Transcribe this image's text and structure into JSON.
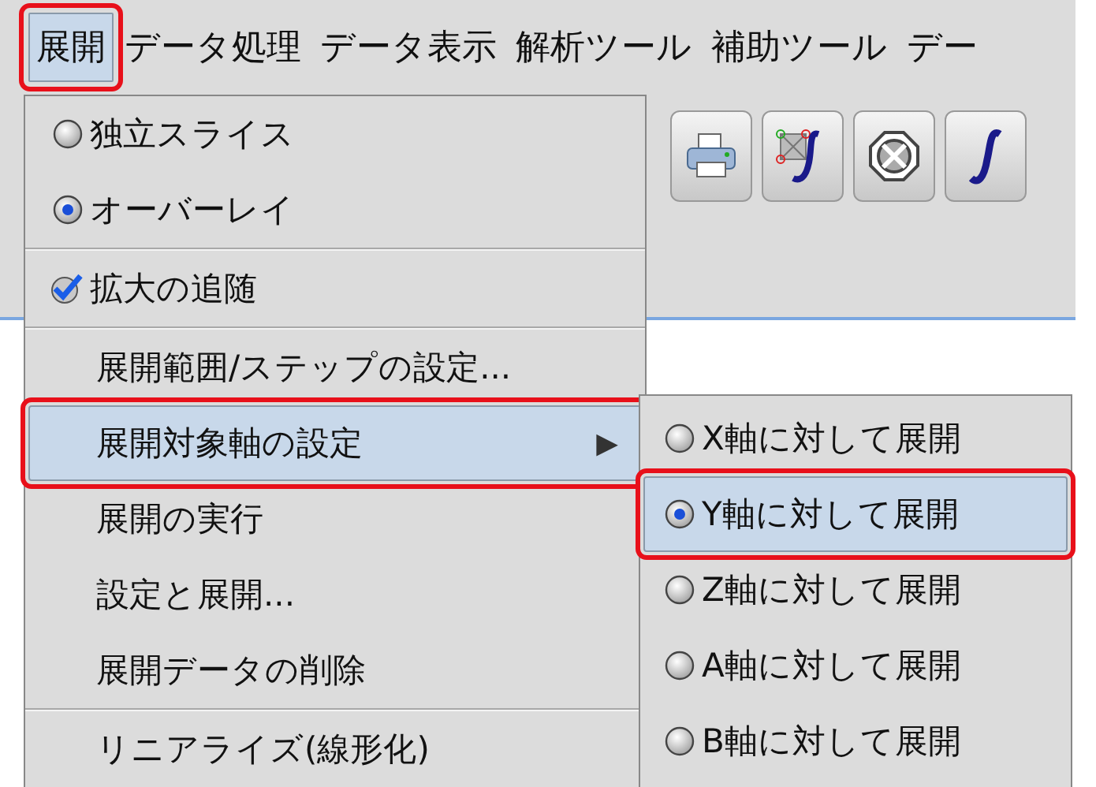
{
  "menubar": [
    {
      "label": "展開",
      "selected": true,
      "annotated": true
    },
    {
      "label": "データ処理",
      "selected": false,
      "annotated": false
    },
    {
      "label": "データ表示",
      "selected": false,
      "annotated": false
    },
    {
      "label": "解析ツール",
      "selected": false,
      "annotated": false
    },
    {
      "label": "補助ツール",
      "selected": false,
      "annotated": false
    },
    {
      "label": "デー",
      "selected": false,
      "annotated": false
    }
  ],
  "menu": {
    "items": [
      {
        "kind": "radio",
        "label": "独立スライス",
        "checked": false
      },
      {
        "kind": "radio",
        "label": "オーバーレイ",
        "checked": true
      },
      {
        "kind": "separator"
      },
      {
        "kind": "check",
        "label": "拡大の追随",
        "checked": true
      },
      {
        "kind": "separator"
      },
      {
        "kind": "action",
        "label": "展開範囲/ステップの設定...",
        "selected": false,
        "annotated": false
      },
      {
        "kind": "submenu",
        "label": "展開対象軸の設定",
        "arrow": "▶",
        "selected": true,
        "annotated": true
      },
      {
        "kind": "action",
        "label": "展開の実行",
        "selected": false,
        "annotated": false
      },
      {
        "kind": "action",
        "label": "設定と展開...",
        "selected": false,
        "annotated": false
      },
      {
        "kind": "action",
        "label": "展開データの削除",
        "selected": false,
        "annotated": false
      },
      {
        "kind": "separator"
      },
      {
        "kind": "action",
        "label": "リニアライズ(線形化)",
        "selected": false,
        "annotated": false
      }
    ]
  },
  "submenu": {
    "items": [
      {
        "label": "X軸に対して展開",
        "checked": false,
        "selected": false,
        "annotated": false
      },
      {
        "label": "Y軸に対して展開",
        "checked": true,
        "selected": true,
        "annotated": true
      },
      {
        "label": "Z軸に対して展開",
        "checked": false,
        "selected": false,
        "annotated": false
      },
      {
        "label": "A軸に対して展開",
        "checked": false,
        "selected": false,
        "annotated": false
      },
      {
        "label": "B軸に対して展開",
        "checked": false,
        "selected": false,
        "annotated": false
      }
    ]
  }
}
